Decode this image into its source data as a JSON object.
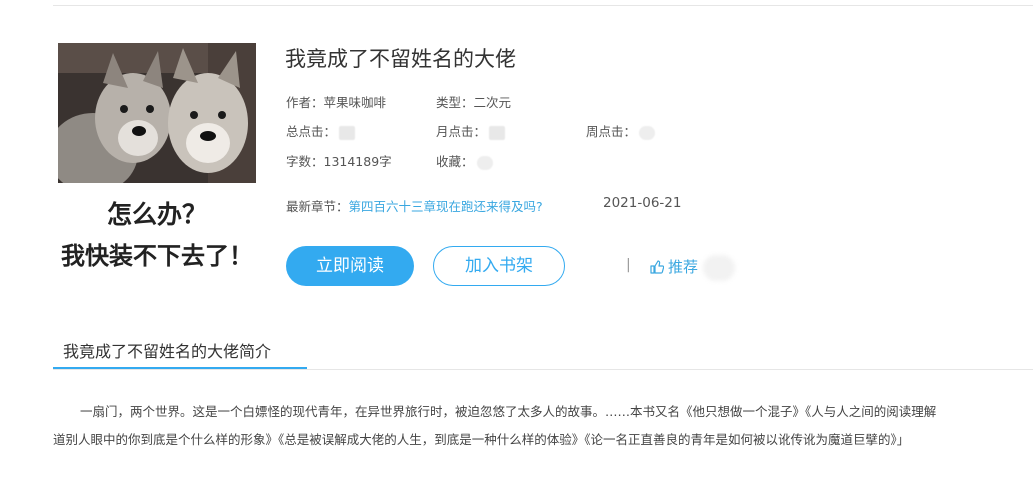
{
  "book": {
    "title": "我竟成了不留姓名的大佬",
    "author": "作者：苹果味咖啡",
    "type": "类型：二次元",
    "total_clicks_label": "总点击：",
    "monthly_clicks_label": "月点击：",
    "weekly_clicks_label": "周点击：",
    "word_count": "字数：1314189字",
    "favorites_label": "收藏：",
    "latest_label": "最新章节：",
    "latest_chapter": "第四百六十三章现在跑还来得及吗?",
    "latest_date": "2021-06-21"
  },
  "cover": {
    "caption_line1": "怎么办？",
    "caption_line2": "我快装不下去了！"
  },
  "actions": {
    "read_label": "立即阅读",
    "shelf_label": "加入书架",
    "divider": "|",
    "recommend_label": "推荐"
  },
  "intro": {
    "tab_label": "我竟成了不留姓名的大佬简介",
    "line1": "一扇门，两个世界。这是一个白嫖怪的现代青年，在异世界旅行时，被迫忽悠了太多人的故事。……本书又名《他只想做一个混子》《人与人之间的阅读理解",
    "line2": "道别人眼中的你到底是个什么样的形象》《总是被误解成大佬的人生，到底是一种什么样的体验》《论一名正直善良的青年是如何被以讹传讹为魔道巨擘的》」"
  },
  "colors": {
    "accent": "#33aaf0",
    "link": "#3aa7e0"
  }
}
